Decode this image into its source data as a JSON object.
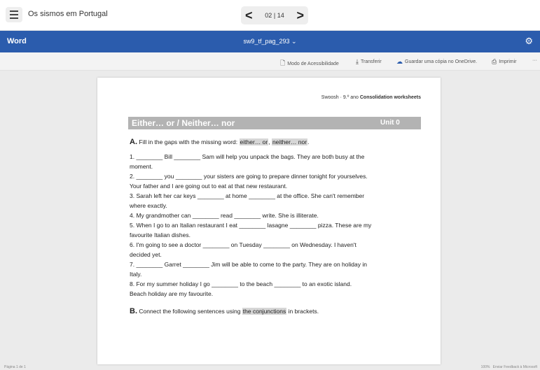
{
  "topbar": {
    "doc_name": "Os sismos em Portugal",
    "pager": {
      "current": "02",
      "separator": "|",
      "total": "14"
    }
  },
  "wordbar": {
    "brand": "Word",
    "file_name": "sw9_tf_pag_293 ⌄"
  },
  "toolbar": {
    "accessibility": "Modo de Acessibilidade",
    "download": "Transferir",
    "onedrive": "Guardar uma cópia no OneDrive.",
    "print": "Imprimir",
    "more": "···"
  },
  "document": {
    "header_prefix": "Swoosh · 9.º ano ",
    "header_bold": "Consolidation worksheets",
    "title": "Either… or / Neither… nor",
    "unit": "Unit 0",
    "sectionA": {
      "letter": "A.",
      "text": " Fill in the gaps with the missing word: ",
      "hl1": "either… or",
      "sep": ", ",
      "hl2": "neither… nor",
      "end": "."
    },
    "lines": [
      "1. ________ Bill ________ Sam will help you unpack the bags. They are both busy at the",
      "moment.",
      "2. ________ you ________ your sisters are going to prepare dinner tonight for yourselves.",
      "Your father and I are going out to eat at that new restaurant.",
      "3. Sarah left her car keys ________ at home ________ at the office. She can't remember",
      "where exactly.",
      "4. My grandmother can ________ read ________ write. She is illiterate.",
      "5. When I go to an Italian restaurant I eat ________ lasagne ________ pizza. These are my",
      "favourite Italian dishes.",
      "6. I'm going to see a doctor ________ on Tuesday ________ on Wednesday. I haven't",
      "decided yet.",
      "7. ________ Garret ________ Jim will be able to come to the party. They are on holiday in",
      "Italy.",
      "8. For my summer holiday I go ________ to the beach ________ to an exotic island.",
      "Beach holiday are my favourite."
    ],
    "sectionB": {
      "letter": "B.",
      "text": " Connect the following sentences using ",
      "hl": "the conjunctions",
      "end": " in brackets."
    }
  },
  "status": {
    "page": "Página 1 de 1",
    "zoom": "100%",
    "feedback": "Enviar Feedback à Microsoft"
  }
}
